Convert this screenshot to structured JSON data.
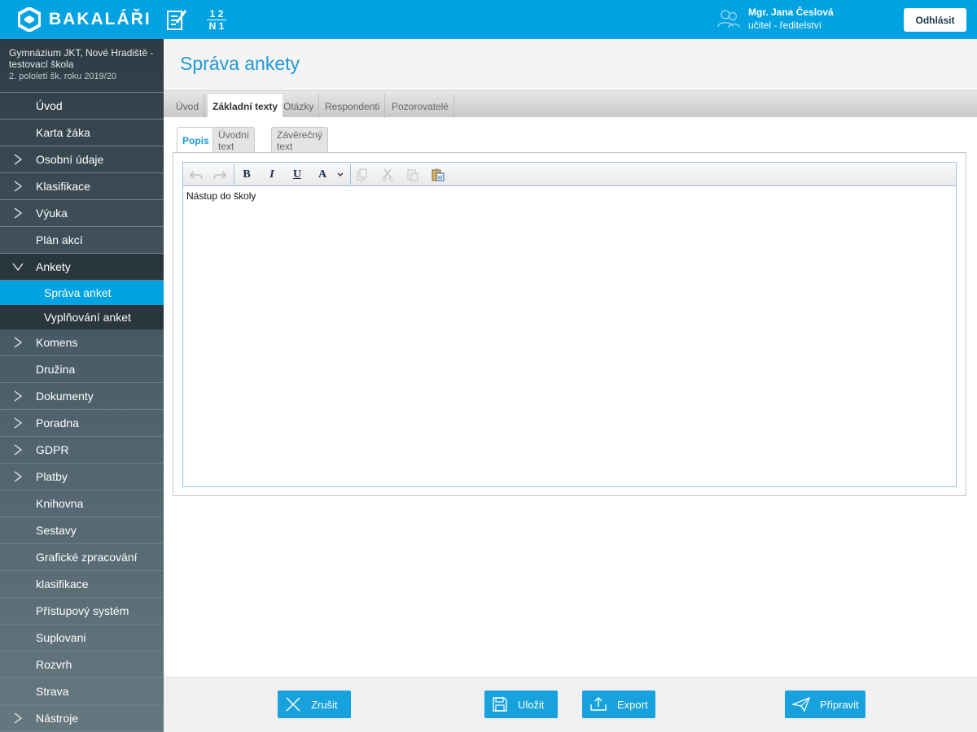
{
  "app": {
    "brand": "BAKALÁŘI",
    "accent": "#00a2e2"
  },
  "header": {
    "grades_top": "1 2",
    "grades_bottom": "N 1",
    "user_name": "Mgr. Jana Česlová",
    "user_role": "učitel - ředitelství",
    "logout_label": "Odhlásit"
  },
  "sidebar": {
    "school_name": "Gymnázium JKT, Nové Hradiště - testovací škola",
    "school_term": "2. pololetí šk. roku 2019/20",
    "items": [
      {
        "label": "Úvod",
        "chevron": "none"
      },
      {
        "label": "Karta žáka",
        "chevron": "none"
      },
      {
        "label": "Osobní údaje",
        "chevron": "right"
      },
      {
        "label": "Klasifikace",
        "chevron": "right"
      },
      {
        "label": "Výuka",
        "chevron": "right"
      },
      {
        "label": "Plán akcí",
        "chevron": "none"
      },
      {
        "label": "Ankety",
        "chevron": "down"
      },
      {
        "label": "Komens",
        "chevron": "right"
      },
      {
        "label": "Družina",
        "chevron": "none"
      },
      {
        "label": "Dokumenty",
        "chevron": "right"
      },
      {
        "label": "Poradna",
        "chevron": "right"
      },
      {
        "label": "GDPR",
        "chevron": "right"
      },
      {
        "label": "Platby",
        "chevron": "right"
      },
      {
        "label": "Knihovna",
        "chevron": "none"
      },
      {
        "label": "Sestavy",
        "chevron": "none"
      },
      {
        "label": "Grafické zpracování",
        "chevron": "none"
      },
      {
        "label": "klasifikace",
        "chevron": "none"
      },
      {
        "label": "Přístupový systém",
        "chevron": "none"
      },
      {
        "label": "Suplovani",
        "chevron": "none"
      },
      {
        "label": "Rozvrh",
        "chevron": "none"
      },
      {
        "label": "Strava",
        "chevron": "none"
      },
      {
        "label": "Nástroje",
        "chevron": "right"
      }
    ],
    "sub_items": [
      {
        "label": "Správa anket",
        "active": true
      },
      {
        "label": "Vyplňování anket",
        "active": false
      }
    ]
  },
  "page": {
    "title": "Správa ankety"
  },
  "tabs": [
    {
      "label": "Úvod",
      "active": false
    },
    {
      "label": "Základní texty",
      "active": true
    },
    {
      "label": "Otázky",
      "active": false
    },
    {
      "label": "Respondenti",
      "active": false
    },
    {
      "label": "Pozorovatelé",
      "active": false
    }
  ],
  "subtabs": [
    {
      "label": "Popis",
      "active": true
    },
    {
      "label": "Úvodní text",
      "active": false
    },
    {
      "label": "Závěrečný text",
      "active": false
    }
  ],
  "editor": {
    "toolbar": {
      "bold": "B",
      "italic": "I",
      "underline": "U",
      "font_color": "A"
    },
    "content": "Nástup do školy"
  },
  "footer": {
    "cancel": "Zrušit",
    "save": "Uložit",
    "export": "Export",
    "prepare": "Připravit"
  }
}
